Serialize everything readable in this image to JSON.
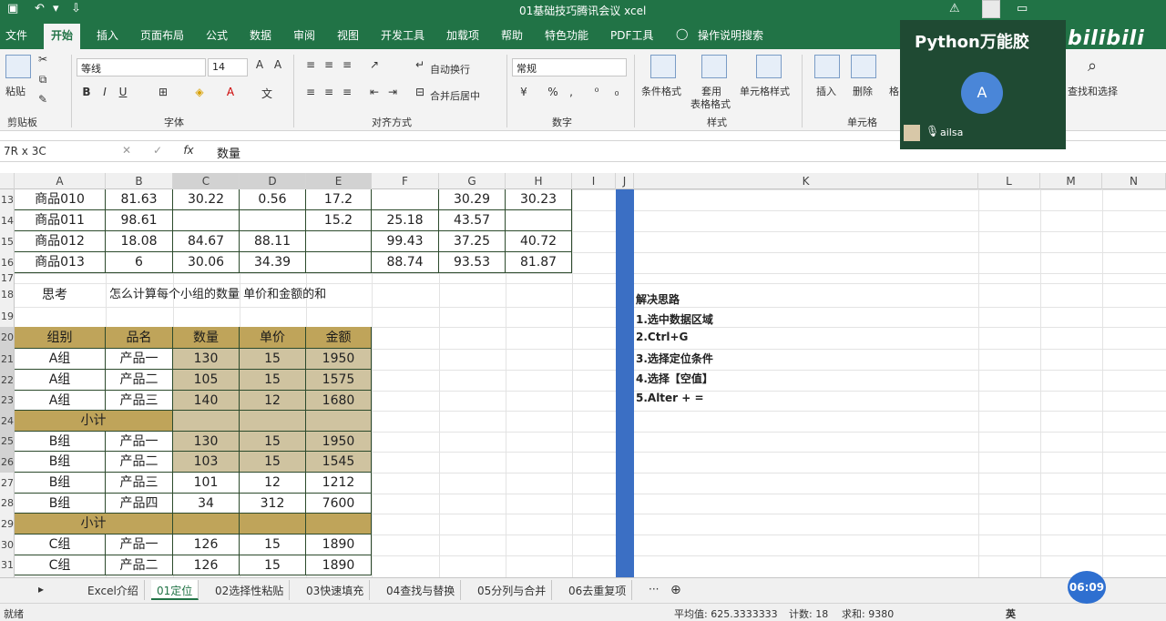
{
  "titlebar": {
    "title": "01基础技巧腾讯会议 xcel",
    "save_icon": "save-icon",
    "undo_icon": "undo-icon"
  },
  "menu": [
    "文件",
    "开始",
    "插入",
    "页面布局",
    "公式",
    "数据",
    "审阅",
    "视图",
    "开发工具",
    "加载项",
    "帮助",
    "特色功能",
    "PDF工具",
    "操作说明搜索"
  ],
  "ribbon": {
    "font_name": "等线",
    "font_size": "14",
    "number_format": "常规",
    "paste": "粘贴",
    "wrap_text": "自动换行",
    "merge_center": "合并后居中",
    "conditional_format": "条件格式",
    "table_format_1": "套用",
    "table_format_2": "表格格式",
    "cell_style": "单元格样式",
    "insert": "插入",
    "delete": "删除",
    "format_short": "格",
    "find_select": "查找和选择",
    "groups": {
      "clipboard": "剪贴板",
      "font": "字体",
      "alignment": "对齐方式",
      "number": "数字",
      "style": "样式",
      "cells": "单元格"
    }
  },
  "formula_bar": {
    "name_box": "7R x 3C",
    "content": "数量",
    "fx": "fx"
  },
  "columns": [
    "A",
    "B",
    "C",
    "D",
    "E",
    "F",
    "G",
    "H",
    "I",
    "J",
    "K",
    "L",
    "M",
    "N"
  ],
  "rows": [
    "13",
    "14",
    "15",
    "16",
    "17",
    "18",
    "19",
    "20",
    "21",
    "22",
    "23",
    "24",
    "25",
    "26",
    "27",
    "28",
    "29",
    "30",
    "31"
  ],
  "products": [
    [
      "商品010",
      "81.63",
      "30.22",
      "0.56",
      "17.2",
      "",
      "30.29",
      "30.23"
    ],
    [
      "商品011",
      "98.61",
      "",
      "",
      "15.2",
      "25.18",
      "43.57",
      ""
    ],
    [
      "商品012",
      "18.08",
      "84.67",
      "88.11",
      "",
      "99.43",
      "37.25",
      "40.72"
    ],
    [
      "商品013",
      "6",
      "30.06",
      "34.39",
      "",
      "88.74",
      "93.53",
      "81.87"
    ]
  ],
  "think": {
    "label": "思考",
    "question": "怎么计算每个小组的数量 单价和金额的和"
  },
  "table_header": [
    "组别",
    "品名",
    "数量",
    "单价",
    "金额"
  ],
  "table_rows": [
    [
      "A组",
      "产品一",
      "130",
      "15",
      "1950"
    ],
    [
      "A组",
      "产品二",
      "105",
      "15",
      "1575"
    ],
    [
      "A组",
      "产品三",
      "140",
      "12",
      "1680"
    ],
    [
      "小计",
      "",
      "",
      "",
      ""
    ],
    [
      "B组",
      "产品一",
      "130",
      "15",
      "1950"
    ],
    [
      "B组",
      "产品二",
      "103",
      "15",
      "1545"
    ],
    [
      "B组",
      "产品三",
      "101",
      "12",
      "1212"
    ],
    [
      "B组",
      "产品四",
      "34",
      "312",
      "7600"
    ],
    [
      "小计",
      "",
      "",
      "",
      ""
    ],
    [
      "C组",
      "产品一",
      "126",
      "15",
      "1890"
    ],
    [
      "C组",
      "产品二",
      "126",
      "15",
      "1890"
    ]
  ],
  "notes": [
    "解决思路",
    "1.选中数据区域",
    "2.Ctrl+G",
    "3.选择定位条件",
    "4.选择【空值】",
    "5.Alter + ="
  ],
  "sheets": [
    "Excel介绍",
    "01定位",
    "02选择性粘贴",
    "03快速填充",
    "04查找与替换",
    "05分列与合并",
    "06去重复项"
  ],
  "status": {
    "ready": "就绪",
    "average": "平均值: 625.3333333",
    "count": "计数: 18",
    "sum": "求和: 9380",
    "ime": "英"
  },
  "meeting": {
    "watermark": "Python万能胶",
    "avatar_letter": "A",
    "user": "ailsa"
  },
  "timer": "06:09",
  "bilibili": "bilibili",
  "colors": {
    "excel_green": "#217346",
    "header_gold": "#bfa45a",
    "selection": "#cfc3a0",
    "blue_bar": "#3b6fc4"
  }
}
